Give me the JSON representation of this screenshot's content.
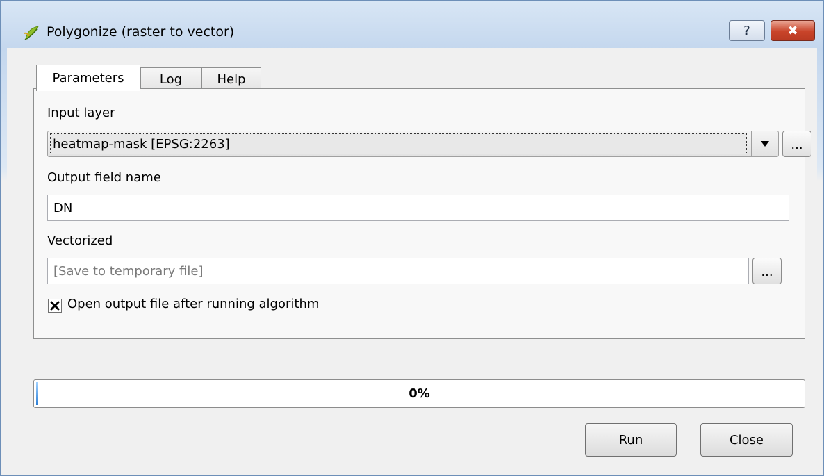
{
  "window": {
    "title": "Polygonize (raster to vector)",
    "help_glyph": "?",
    "close_glyph": "✖"
  },
  "tabs": [
    {
      "label": "Parameters",
      "active": true
    },
    {
      "label": "Log",
      "active": false
    },
    {
      "label": "Help",
      "active": false
    }
  ],
  "params": {
    "input_layer": {
      "label": "Input layer",
      "value": "heatmap-mask [EPSG:2263]",
      "browse": "..."
    },
    "output_field": {
      "label": "Output field name",
      "value": "DN"
    },
    "vectorized": {
      "label": "Vectorized",
      "placeholder": "[Save to temporary file]",
      "browse": "..."
    },
    "open_output": {
      "label": "Open output file after running algorithm",
      "checked": true
    }
  },
  "progress": {
    "value": 0,
    "text": "0%"
  },
  "buttons": {
    "run": "Run",
    "close": "Close"
  },
  "colors": {
    "close_red": "#c9442a",
    "progress_blue": "#2b7fd6"
  },
  "icons": {
    "app": "qgis-logo-icon",
    "dropdown": "chevron-down-icon",
    "checkbox": "checkbox-checked-icon"
  }
}
